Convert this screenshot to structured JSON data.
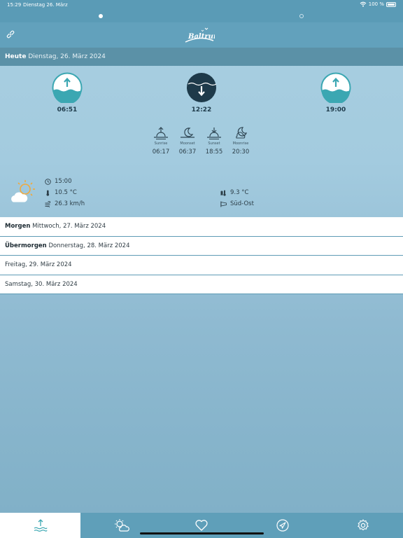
{
  "status": {
    "time": "15:29",
    "date": "Dienstag 26. März",
    "battery": "100 %"
  },
  "header": {
    "logo_text": "Baltrum",
    "link_icon": "link-icon"
  },
  "today": {
    "label": "Heute",
    "date": "Dienstag, 26. März 2024"
  },
  "tides": [
    {
      "type": "high",
      "time": "06:51"
    },
    {
      "type": "low",
      "time": "12:22"
    },
    {
      "type": "high",
      "time": "19:00"
    }
  ],
  "astro": [
    {
      "label": "Sunrise",
      "time": "06:17",
      "icon": "sunrise-icon"
    },
    {
      "label": "Moonset",
      "time": "06:37",
      "icon": "moonset-icon"
    },
    {
      "label": "Sunset",
      "time": "18:55",
      "icon": "sunset-icon"
    },
    {
      "label": "Moonrise",
      "time": "20:30",
      "icon": "moonrise-icon"
    }
  ],
  "weather": {
    "icon": "partly-cloudy-icon",
    "time": "15:00",
    "air_temp": "10.5 °C",
    "wind_speed": "26.3 km/h",
    "water_temp": "9.3 °C",
    "wind_direction": "Süd-Ost"
  },
  "days": [
    {
      "label": "Morgen",
      "date": "Mittwoch, 27. März 2024"
    },
    {
      "label": "Übermorgen",
      "date": "Donnerstag, 28. März 2024"
    },
    {
      "label": "",
      "date": "Freitag, 29. März 2024"
    },
    {
      "label": "",
      "date": "Samstag, 30. März 2024"
    }
  ],
  "tabs": [
    {
      "icon": "tides-icon",
      "active": true
    },
    {
      "icon": "weather-icon",
      "active": false
    },
    {
      "icon": "heart-icon",
      "active": false
    },
    {
      "icon": "navigation-icon",
      "active": false
    },
    {
      "icon": "settings-icon",
      "active": false
    }
  ],
  "colors": {
    "accent": "#3ba7b2",
    "dark_tide": "#1e3a4a",
    "header": "#62a1bc",
    "bar": "#5b91a7",
    "sun": "#f1a93c"
  }
}
